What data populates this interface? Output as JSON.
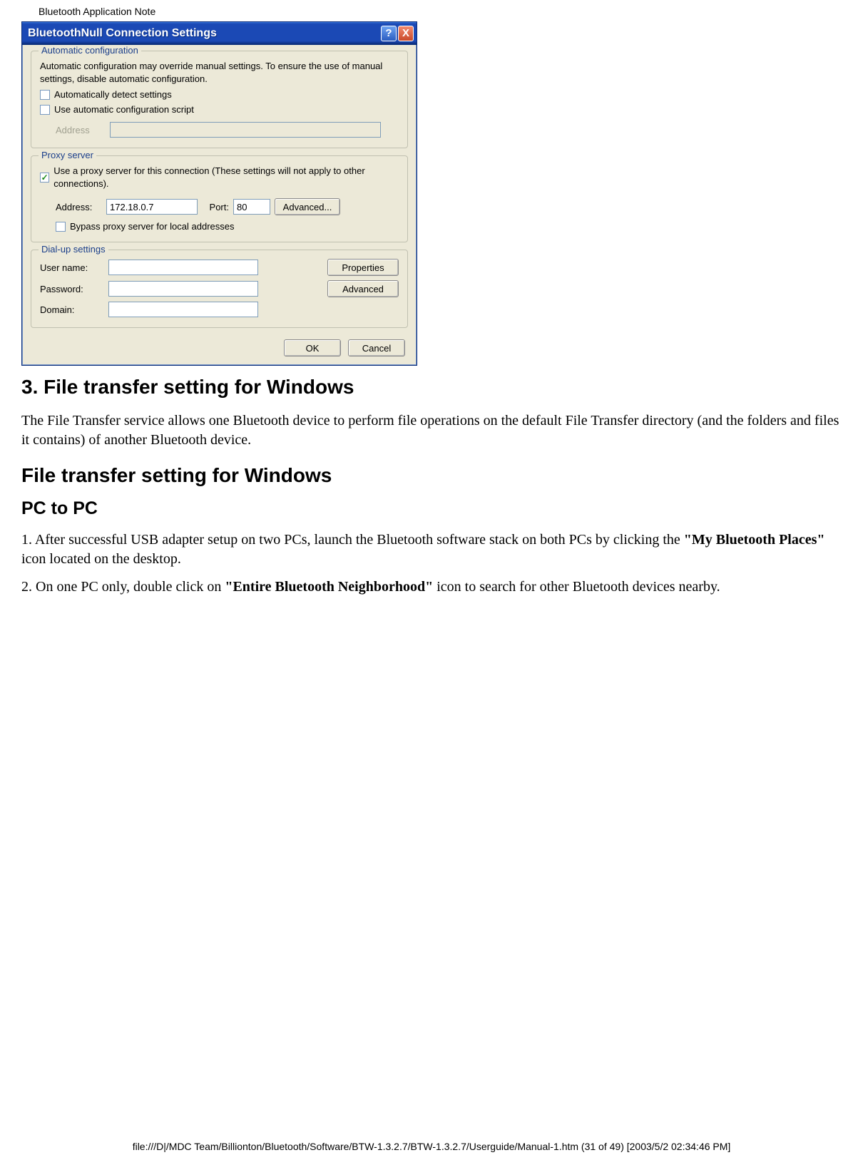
{
  "page": {
    "header": "Bluetooth Application Note",
    "footer": "file:///D|/MDC Team/Billionton/Bluetooth/Software/BTW-1.3.2.7/BTW-1.3.2.7/Userguide/Manual-1.htm (31 of 49) [2003/5/2 02:34:46 PM]"
  },
  "dialog": {
    "title": "BluetoothNull Connection Settings",
    "help_glyph": "?",
    "close_glyph": "X",
    "check_glyph": "✓",
    "ok": "OK",
    "cancel": "Cancel",
    "groups": {
      "auto": {
        "legend": "Automatic configuration",
        "desc": "Automatic configuration may override manual settings.  To ensure the use of manual settings, disable automatic configuration.",
        "cb1": "Automatically detect settings",
        "cb2": "Use automatic configuration script",
        "address_lbl": "Address",
        "address_val": ""
      },
      "proxy": {
        "legend": "Proxy server",
        "use_proxy": "Use a proxy server for this connection (These settings will not apply to other connections).",
        "address_lbl": "Address:",
        "address_val": "172.18.0.7",
        "port_lbl": "Port:",
        "port_val": "80",
        "advanced_btn": "Advanced...",
        "bypass": "Bypass proxy server for local addresses"
      },
      "dialup": {
        "legend": "Dial-up settings",
        "user_lbl": "User name:",
        "user_val": "",
        "pass_lbl": "Password:",
        "pass_val": "",
        "domain_lbl": "Domain:",
        "domain_val": "",
        "properties_btn": "Properties",
        "advanced_btn": "Advanced"
      }
    }
  },
  "doc": {
    "h_section": "3. File transfer setting for Windows",
    "p_intro": "The File Transfer service allows one Bluetooth device to perform file operations on the default File Transfer directory (and the folders and files it contains) of another Bluetooth device.",
    "h_sub": "File transfer setting for Windows",
    "h_pc": "PC to PC",
    "p1_a": "1. After successful USB adapter setup on two PCs, launch the Bluetooth software stack on both PCs by clicking the ",
    "p1_b": "\"My Bluetooth Places\"",
    "p1_c": " icon located on the desktop.",
    "p2_a": "2. On one PC only, double click on ",
    "p2_b": "\"Entire Bluetooth Neighborhood\"",
    "p2_c": " icon to search for other Bluetooth devices nearby."
  }
}
